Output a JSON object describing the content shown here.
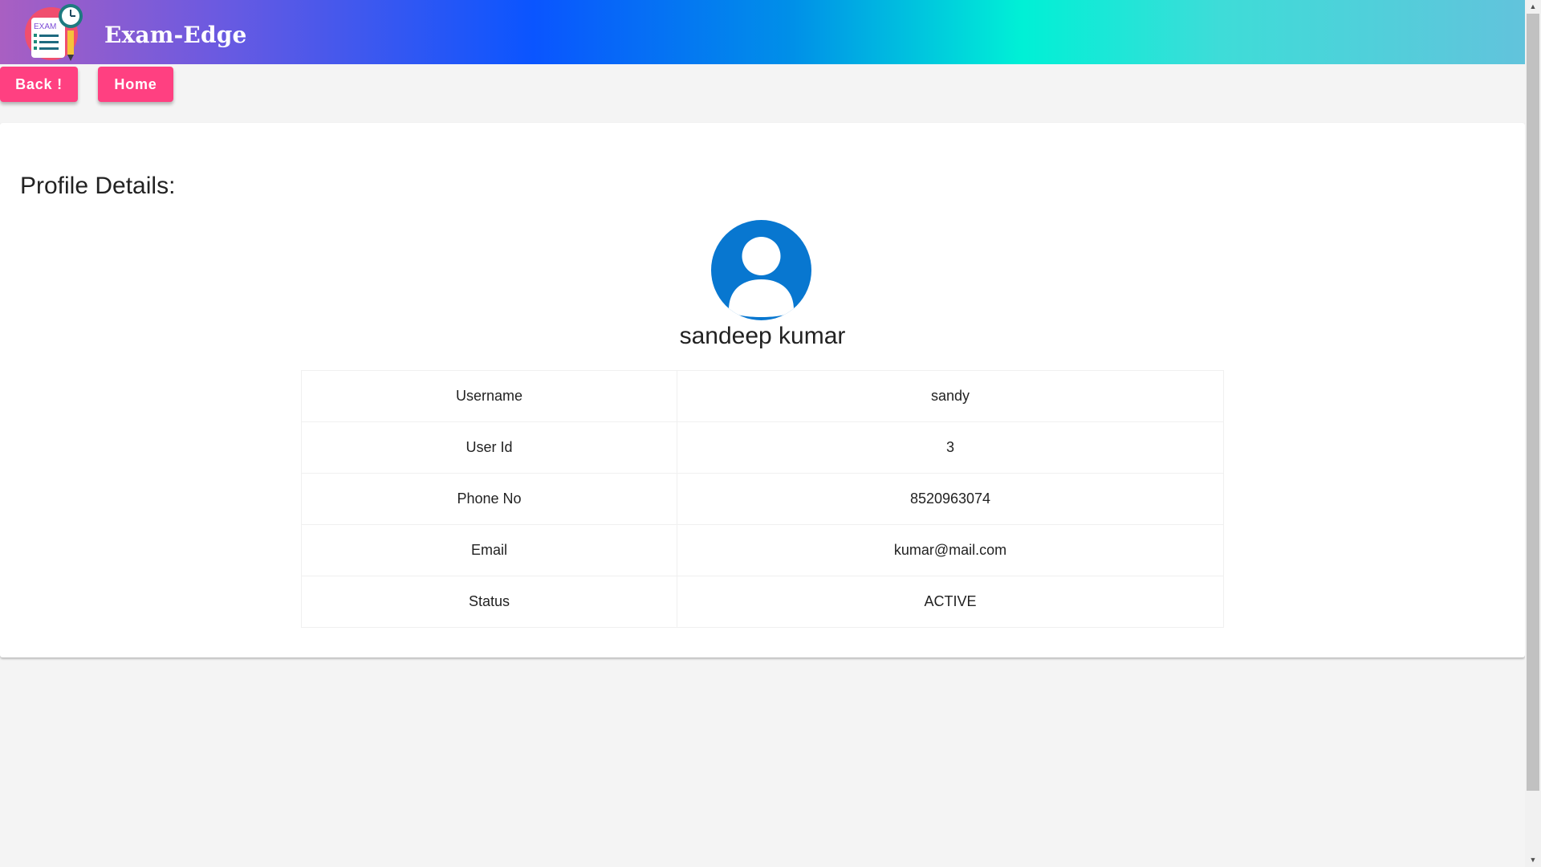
{
  "header": {
    "brand": "Exam-Edge",
    "logo_icon": "exam-logo-icon",
    "logo_text": "EXAM"
  },
  "nav": {
    "back_label": "Back !",
    "home_label": "Home"
  },
  "profile": {
    "section_title": "Profile Details:",
    "avatar_icon": "user-avatar-icon",
    "full_name": "sandeep kumar",
    "rows": [
      {
        "label": "Username",
        "value": "sandy"
      },
      {
        "label": "User Id",
        "value": "3"
      },
      {
        "label": "Phone No",
        "value": "8520963074"
      },
      {
        "label": "Email",
        "value": "kumar@mail.com"
      },
      {
        "label": "Status",
        "value": "ACTIVE"
      }
    ]
  },
  "colors": {
    "accent_button": "#ff4081",
    "avatar": "#0877d0",
    "header_gradient": [
      "#a95fc2",
      "#0a55ff",
      "#00f0d6",
      "#62c3dc"
    ]
  }
}
